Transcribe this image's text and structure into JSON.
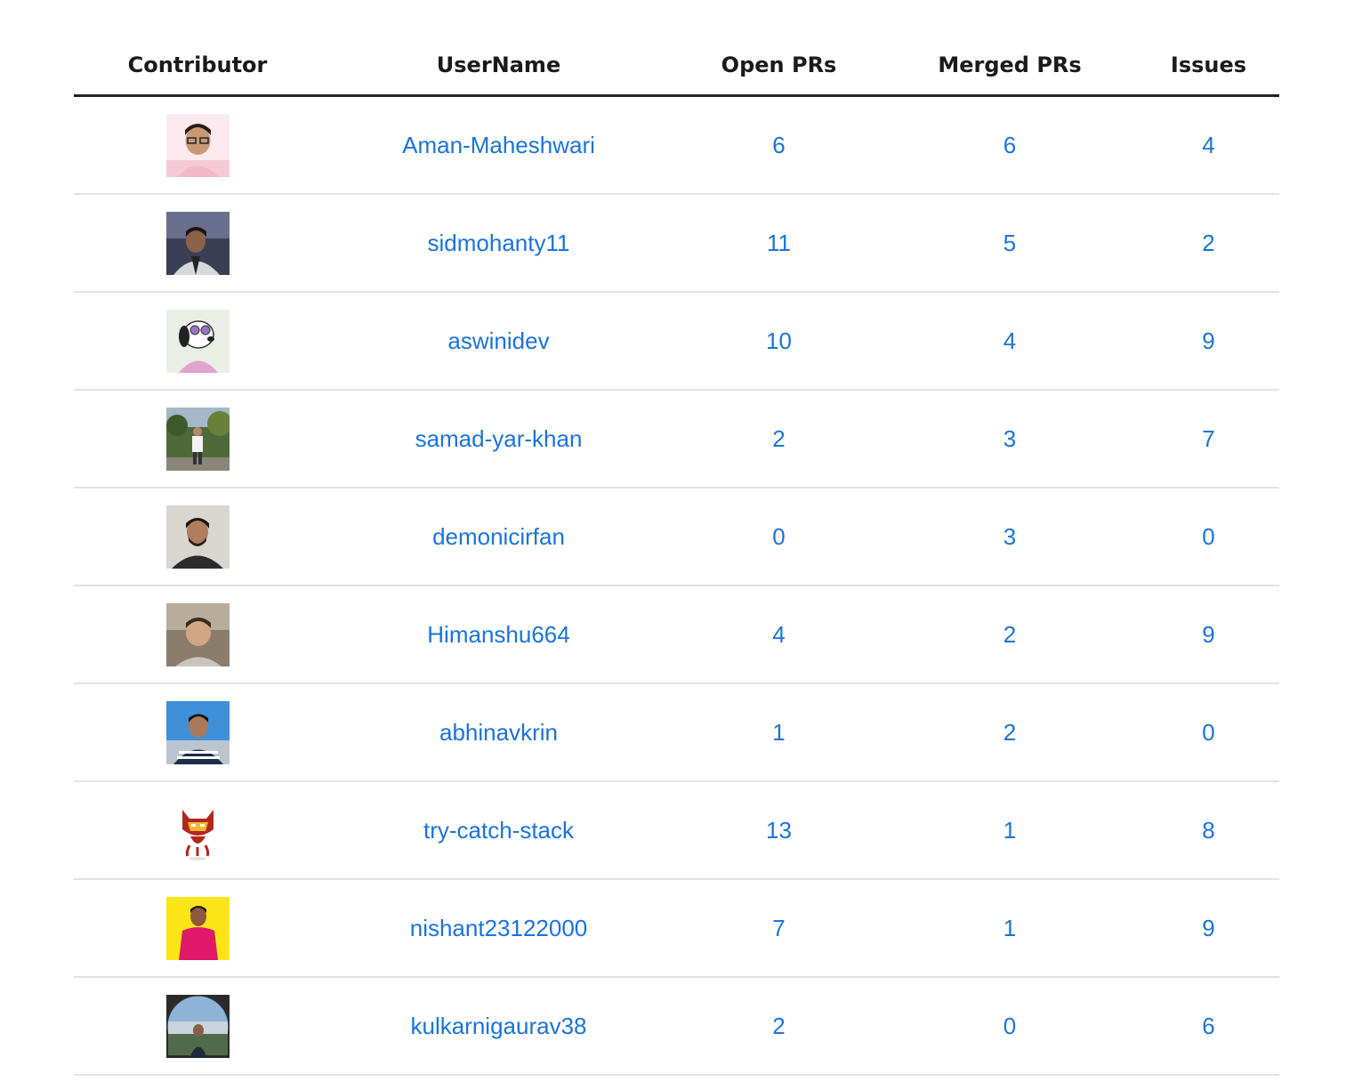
{
  "header": {
    "contributor": "Contributor",
    "username": "UserName",
    "open_prs": "Open PRs",
    "merged_prs": "Merged PRs",
    "issues": "Issues"
  },
  "colors": {
    "link": "#1a73d9",
    "header_text": "#1a1a1a",
    "header_rule": "#222222",
    "row_rule": "#e2e2e2"
  },
  "rows": [
    {
      "username": "Aman-Maheshwari",
      "open_prs": "6",
      "merged_prs": "6",
      "issues": "4",
      "avatar": "avatar-photo"
    },
    {
      "username": "sidmohanty11",
      "open_prs": "11",
      "merged_prs": "5",
      "issues": "2",
      "avatar": "avatar-photo"
    },
    {
      "username": "aswinidev",
      "open_prs": "10",
      "merged_prs": "4",
      "issues": "9",
      "avatar": "avatar-cartoon-dog"
    },
    {
      "username": "samad-yar-khan",
      "open_prs": "2",
      "merged_prs": "3",
      "issues": "7",
      "avatar": "avatar-photo"
    },
    {
      "username": "demonicirfan",
      "open_prs": "0",
      "merged_prs": "3",
      "issues": "0",
      "avatar": "avatar-photo"
    },
    {
      "username": "Himanshu664",
      "open_prs": "4",
      "merged_prs": "2",
      "issues": "9",
      "avatar": "avatar-photo"
    },
    {
      "username": "abhinavkrin",
      "open_prs": "1",
      "merged_prs": "2",
      "issues": "0",
      "avatar": "avatar-photo"
    },
    {
      "username": "try-catch-stack",
      "open_prs": "13",
      "merged_prs": "1",
      "issues": "8",
      "avatar": "avatar-octocat-ironman"
    },
    {
      "username": "nishant23122000",
      "open_prs": "7",
      "merged_prs": "1",
      "issues": "9",
      "avatar": "avatar-photo"
    },
    {
      "username": "kulkarnigaurav38",
      "open_prs": "2",
      "merged_prs": "0",
      "issues": "6",
      "avatar": "avatar-photo-circle"
    }
  ]
}
